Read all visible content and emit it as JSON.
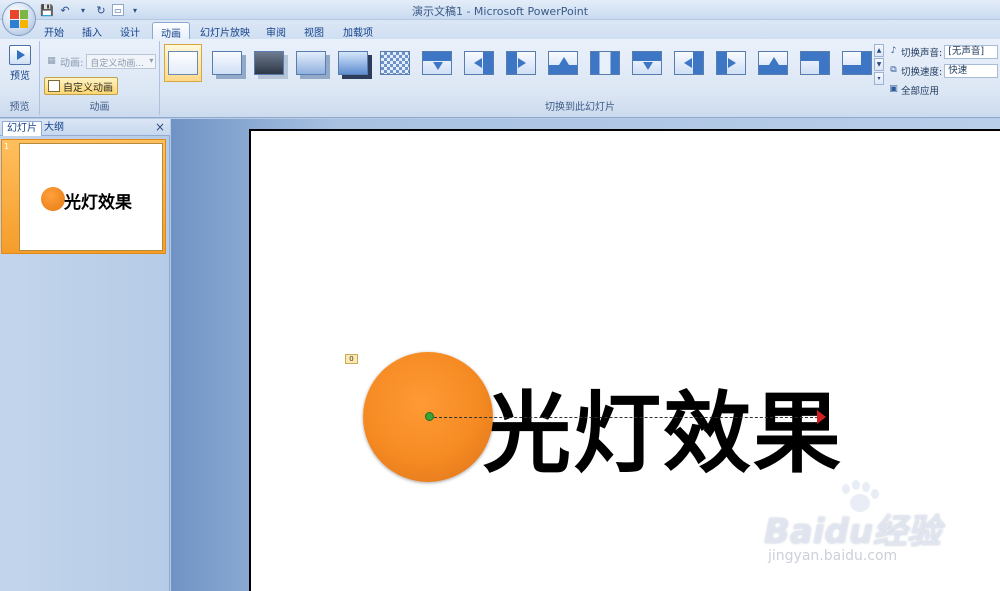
{
  "window": {
    "title": "演示文稿1 - Microsoft PowerPoint"
  },
  "qat": {
    "save_icon": "save-icon",
    "undo_icon": "undo-icon",
    "redo_icon": "redo-icon",
    "customize_icon": "customize-icon"
  },
  "tabs": [
    {
      "label": "开始"
    },
    {
      "label": "插入"
    },
    {
      "label": "设计"
    },
    {
      "label": "动画"
    },
    {
      "label": "幻灯片放映"
    },
    {
      "label": "审阅"
    },
    {
      "label": "视图"
    },
    {
      "label": "加载项"
    }
  ],
  "active_tab": "动画",
  "ribbon": {
    "preview": {
      "button_label": "预览",
      "group_label": "预览"
    },
    "animation": {
      "animate_label": "动画:",
      "animate_value": "自定义动画...",
      "custom_button": "自定义动画",
      "group_label": "动画"
    },
    "transition": {
      "group_label": "切换到此幻灯片",
      "sound_label": "切换声音:",
      "sound_value": "[无声音]",
      "speed_label": "切换速度:",
      "speed_value": "快速",
      "apply_all": "全部应用"
    }
  },
  "left_pane": {
    "tab_slides": "幻灯片",
    "tab_outline": "大纲",
    "close": "×",
    "slide_number": "1",
    "thumbnail_text": "光灯效果"
  },
  "slide": {
    "title_text": "光灯效果",
    "anim_tag": "0"
  },
  "watermark": {
    "main": "Baidu经验",
    "sub": "jingyan.baidu.com"
  },
  "colors": {
    "accent_orange": "#f58a22",
    "ribbon_blue": "#dbe6f4",
    "selected_gallery": "#ffd98a"
  }
}
